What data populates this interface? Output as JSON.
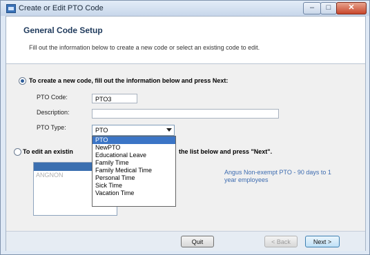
{
  "window": {
    "title": "Create or Edit PTO Code",
    "controls": [
      "–",
      "□",
      "✕"
    ]
  },
  "header": {
    "title": "General Code Setup",
    "subtitle": "Fill out the information below to create a new code or select an existing code to edit."
  },
  "option_create": {
    "label": "To create a new code, fill out the information below and press Next:",
    "selected": true
  },
  "fields": {
    "pto_code_label": "PTO Code:",
    "pto_code_value": "PTO3",
    "description_label": "Description:",
    "description_value": "",
    "pto_type_label": "PTO Type:",
    "pto_type_value": "PTO"
  },
  "option_edit": {
    "label_start": "To edit an existin",
    "label_end": "the list below and press \"Next\".",
    "selected": false
  },
  "existing_list": {
    "items": [
      "ANGNON"
    ]
  },
  "existing_description": "Angus Non-exempt PTO - 90 days to 1 year employees",
  "dropdown": {
    "items": [
      "PTO",
      "NewPTO",
      "Educational Leave",
      "Family Time",
      "Family Medical Time",
      "Personal Time",
      "Sick Time",
      "Vacation Time"
    ],
    "selected_index": 0
  },
  "buttons": {
    "quit": "Quit",
    "back": "< Back",
    "next": "Next >"
  },
  "colors": {
    "accent": "#3b75c6",
    "title_blue": "#1e395b",
    "link_blue": "#3c6bb0"
  }
}
